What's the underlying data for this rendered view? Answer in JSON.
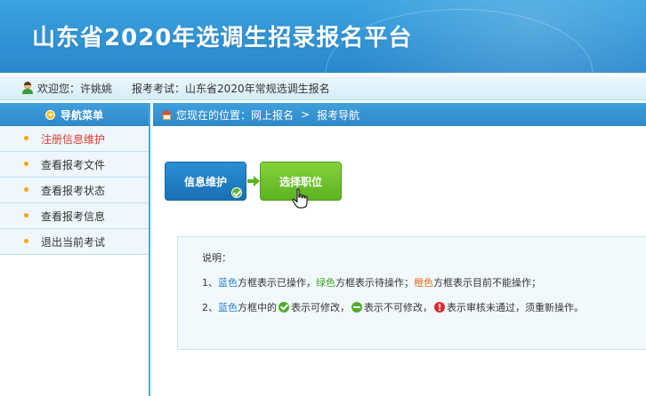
{
  "header": {
    "title": "山东省2020年选调生招录报名平台"
  },
  "infobar": {
    "welcome_prefix": "欢迎您：",
    "user_name": "许姚姚",
    "exam_prefix": "报考考试：",
    "exam_name": "山东省2020年常规选调生报名"
  },
  "sidebar": {
    "title": "导航菜单",
    "items": [
      {
        "label": "注册信息维护"
      },
      {
        "label": "查看报考文件"
      },
      {
        "label": "查看报考状态"
      },
      {
        "label": "查看报考信息"
      },
      {
        "label": "退出当前考试"
      }
    ]
  },
  "breadcrumb": {
    "prefix": "您现在的位置：",
    "level1": "网上报名",
    "separator": ">",
    "level2": "报考导航"
  },
  "steps": {
    "step1": "信息维护",
    "step2": "选择职位"
  },
  "notes": {
    "heading": "说明：",
    "line1": {
      "num": "1、",
      "blue": "蓝色",
      "t1": "方框表示已操作，",
      "green": "绿色",
      "t2": "方框表示待操作；",
      "orange": "橙色",
      "t3": "方框表示目前不能操作；"
    },
    "line2": {
      "num": "2、",
      "blue": "蓝色",
      "t1": "方框中的",
      "t2": "表示可修改，",
      "t3": "表示不可修改，",
      "t4": "表示审核未通过，须重新操作。"
    }
  },
  "colors": {
    "header_blue": "#2f92d4",
    "nav_blue": "#2e87c9",
    "step_blue": "#1a6fb4",
    "step_green": "#5cb221",
    "active_red": "#e03b2e",
    "note_blue": "#2a7fc7",
    "note_green": "#3fa525",
    "note_orange": "#e76a1a"
  }
}
